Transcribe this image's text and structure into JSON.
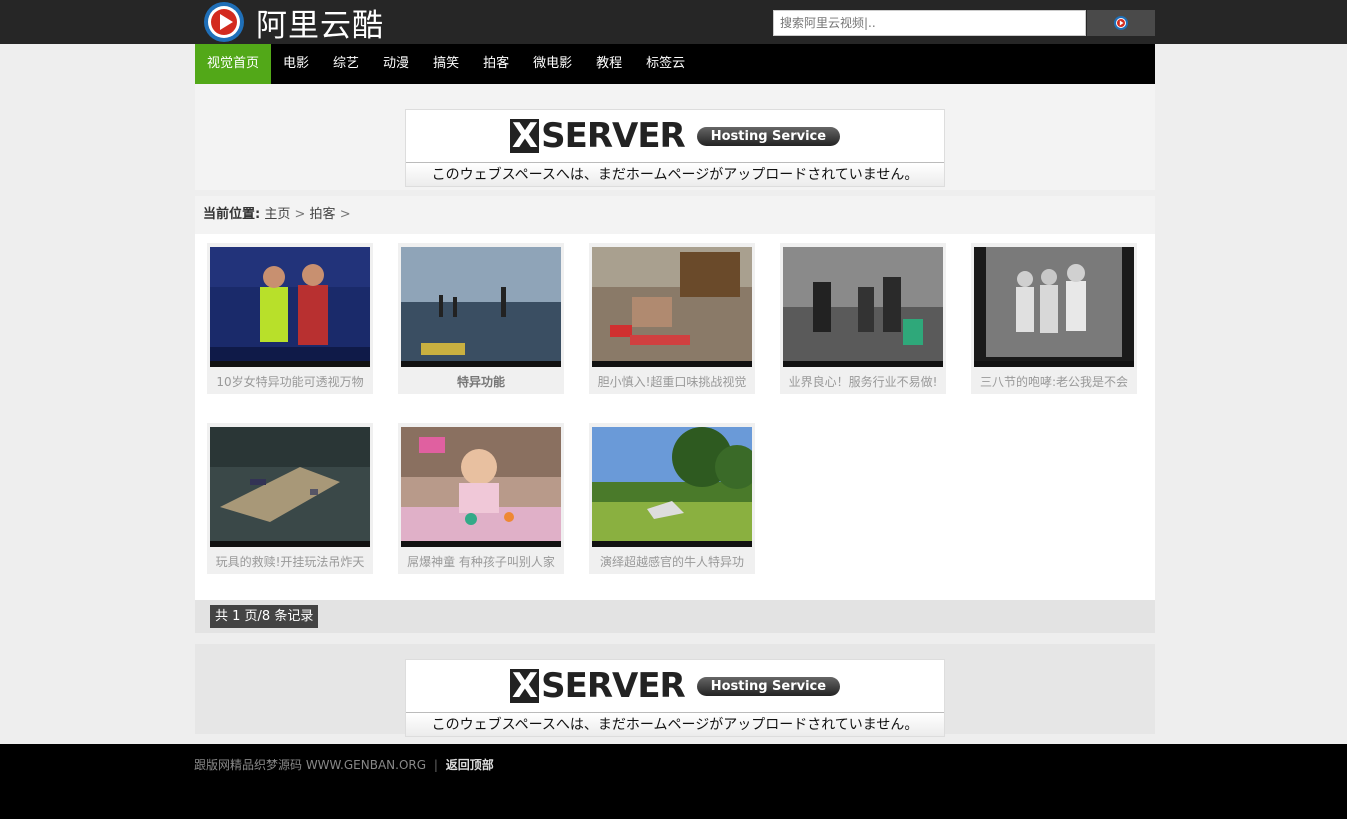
{
  "header": {
    "site_name": "阿里云酷",
    "search_placeholder": "搜索阿里云视频|..",
    "brand_color": "#52a818"
  },
  "nav": {
    "items": [
      {
        "label": "视觉首页",
        "active": true
      },
      {
        "label": "电影"
      },
      {
        "label": "综艺"
      },
      {
        "label": "动漫"
      },
      {
        "label": "搞笑"
      },
      {
        "label": "拍客"
      },
      {
        "label": "微电影"
      },
      {
        "label": "教程"
      },
      {
        "label": "标签云"
      }
    ]
  },
  "ad": {
    "brand": "SERVER",
    "brand_initial": "X",
    "tag": "Hosting Service",
    "message": "このウェブスペースへは、まだホームページがアップロードされていません。"
  },
  "breadcrumb": {
    "label": "当前位置:",
    "items": [
      "主页",
      "拍客"
    ],
    "separator": ">"
  },
  "videos": [
    {
      "title": "10岁女特异功能可透视万物"
    },
    {
      "title": "特异功能"
    },
    {
      "title": "胆小慎入!超重口味挑战视觉"
    },
    {
      "title": "业界良心！服务行业不易做!"
    },
    {
      "title": "三八节的咆哮:老公我是不会"
    },
    {
      "title": "玩具的救赎!开挂玩法吊炸天"
    },
    {
      "title": "屌爆神童 有种孩子叫别人家"
    },
    {
      "title": "演绎超越感官的牛人特异功"
    }
  ],
  "pager": {
    "text": "共 1 页/8 条记录"
  },
  "footer": {
    "text": "跟版网精品织梦源码 WWW.GENBAN.ORG",
    "separator": "|",
    "back_to_top": "返回顶部"
  }
}
